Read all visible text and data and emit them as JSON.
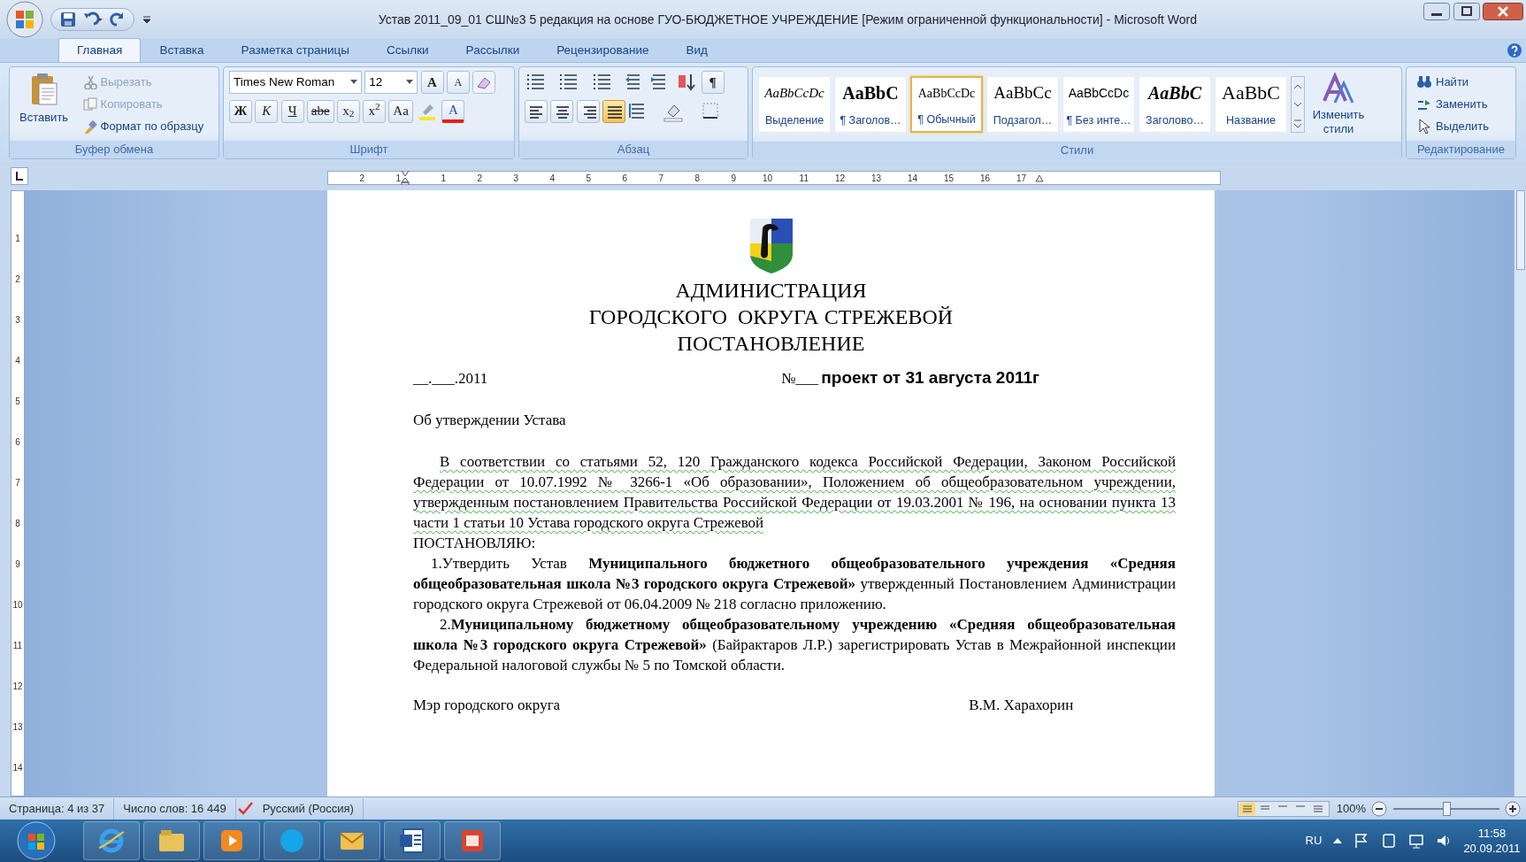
{
  "window": {
    "title": "Устав 2011_09_01 СШ№3 5 редакция на основе ГУО-БЮДЖЕТНОЕ УЧРЕЖДЕНИЕ [Режим ограниченной функциональности] - Microsoft Word"
  },
  "tabs": [
    {
      "label": "Главная",
      "selected": true
    },
    {
      "label": "Вставка",
      "selected": false
    },
    {
      "label": "Разметка страницы",
      "selected": false
    },
    {
      "label": "Ссылки",
      "selected": false
    },
    {
      "label": "Рассылки",
      "selected": false
    },
    {
      "label": "Рецензирование",
      "selected": false
    },
    {
      "label": "Вид",
      "selected": false
    }
  ],
  "clipboard": {
    "paste": "Вставить",
    "items": [
      {
        "kind": "cut",
        "label": "Вырезать",
        "disabled": true
      },
      {
        "kind": "copy",
        "label": "Копировать",
        "disabled": true
      },
      {
        "kind": "painter",
        "label": "Формат по образцу",
        "disabled": false
      }
    ],
    "label": "Буфер обмена"
  },
  "font": {
    "name": "Times New Roman",
    "size": "12",
    "grow": "A",
    "shrink": "A",
    "format_buttons": [
      "Ж",
      "К",
      "Ч",
      "abe",
      "x$_{2}$",
      "x$^{2}$",
      "Aa"
    ],
    "color_button": "A",
    "label": "Шрифт"
  },
  "paragraph": {
    "pilcrow": "¶",
    "alignments": [
      {
        "kind": "left",
        "selected": false
      },
      {
        "kind": "center",
        "selected": false
      },
      {
        "kind": "right",
        "selected": false
      },
      {
        "kind": "justify",
        "selected": true
      }
    ],
    "label": "Абзац"
  },
  "styles": {
    "items": [
      {
        "kind": "emphasis",
        "sample": "AaBbCcDc",
        "label": "Выделение",
        "selected": false
      },
      {
        "kind": "heading",
        "sample": "AaBbC",
        "label": "¶ Заголов…",
        "selected": false
      },
      {
        "kind": "normal",
        "sample": "AaBbCcDc",
        "label": "¶ Обычный",
        "selected": true
      },
      {
        "kind": "subheading",
        "sample": "AaBbCc",
        "label": "Подзагол…",
        "selected": false
      },
      {
        "kind": "nospacing",
        "sample": "AaBbCcDc",
        "label": "¶ Без инте…",
        "selected": false
      },
      {
        "kind": "heading_italic",
        "sample": "AaBbC",
        "label": "Заголово…",
        "selected": false
      },
      {
        "kind": "title",
        "sample": "AaBbC",
        "label": "Название",
        "selected": false
      }
    ],
    "change": "Изменить стили",
    "label": "Стили"
  },
  "editing": {
    "items": [
      {
        "kind": "find",
        "label": "Найти"
      },
      {
        "kind": "replace",
        "label": "Заменить"
      },
      {
        "kind": "select",
        "label": "Выделить"
      }
    ],
    "label": "Редактирование"
  },
  "ruler": {
    "left_marks": [
      "2",
      "1"
    ],
    "marks": [
      "1",
      "2",
      "3",
      "4",
      "5",
      "6",
      "7",
      "8",
      "9",
      "10",
      "11",
      "12",
      "13",
      "14",
      "15",
      "16",
      "17"
    ]
  },
  "vertical_ruler": {
    "marks": [
      "1",
      "2",
      "3",
      "4",
      "5",
      "6",
      "7",
      "8",
      "9",
      "10",
      "11",
      "12",
      "13",
      "14"
    ]
  },
  "document": {
    "heading": [
      "АДМИНИСТРАЦИЯ",
      "ГОРОДСКОГО  ОКРУГА СТРЕЖЕВОЙ",
      "ПОСТАНОВЛЕНИЕ"
    ],
    "date": "__.___.2011",
    "number": "№___",
    "project": "проект от 31 августа 2011г",
    "subject": "Об утверждении Устава",
    "paragraphs": [
      {
        "kind": "indented",
        "grammar_flag": true,
        "text": "В соответствии со статьями 52, 120 Гражданского кодекса Российской Федерации, Законом Российской Федерации от 10.07.1992 № 3266-1 «Об образовании», Положением об общеобразовательном учреждении, утвержденным  постановлением Правительства Российской Федерации от 19.03.2001  № 196, на основании пункта 13 части 1 статьи 10 Устава городского округа Стрежевой"
      },
      {
        "kind": "plain",
        "grammar_flag": false,
        "text": "ПОСТАНОВЛЯЮ:"
      },
      {
        "kind": "item",
        "grammar_flag": false,
        "text": "1.Утвердить Устав **Муниципального бюджетного общеобразовательного учреждения «Средняя общеобразовательная школа №3 городского округа Стрежевой»** утвержденный Постановлением Администрации городского округа Стрежевой от 06.04.2009 № 218 согласно приложению."
      },
      {
        "kind": "indented",
        "grammar_flag": false,
        "text": "2.**Муниципальному бюджетному общеобразовательному учреждению «Средняя общеобразовательная школа №3 городского округа Стрежевой»** (Байрактаров Л.Р.) зарегистрировать Устав  в Межрайонной инспекции Федеральной налоговой службы № 5 по Томской области."
      }
    ],
    "signature_title": "Мэр городского округа",
    "signature_name": "В.М. Харахорин"
  },
  "status_bar": {
    "items": [
      "Страница: 4 из 37",
      "Число слов: 16 449",
      "Русский (Россия)"
    ],
    "zoom": "100%",
    "zoom_level": {
      "level": 0.5
    }
  },
  "taskbar": {
    "apps": [
      {
        "kind": "ie"
      },
      {
        "kind": "folder"
      },
      {
        "kind": "media"
      },
      {
        "kind": "skype"
      },
      {
        "kind": "mail"
      },
      {
        "kind": "word"
      },
      {
        "kind": "red"
      }
    ],
    "language": "RU",
    "time": "11:58",
    "date": "20.09.2011"
  }
}
